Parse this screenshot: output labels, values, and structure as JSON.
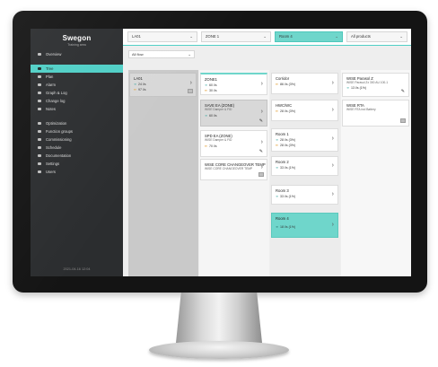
{
  "app": {
    "logo": "Swegon",
    "logo_sub": "Training area"
  },
  "sidebar": {
    "items": [
      {
        "label": "Overview",
        "icon": "dashboard-icon"
      },
      {
        "label": "Tree",
        "icon": "tree-icon",
        "active": true
      },
      {
        "label": "Plan",
        "icon": "map-pin-icon"
      },
      {
        "label": "Alarm",
        "icon": "bell-icon"
      },
      {
        "label": "Graph & Log",
        "icon": "graph-icon"
      },
      {
        "label": "Change log",
        "icon": "clipboard-icon"
      },
      {
        "label": "Notes",
        "icon": "note-icon"
      },
      {
        "label": "Optimization",
        "icon": "optimization-icon"
      },
      {
        "label": "Function groups",
        "icon": "puzzle-icon"
      },
      {
        "label": "Commissioning",
        "icon": "grid-icon"
      },
      {
        "label": "Schedule",
        "icon": "calendar-icon"
      },
      {
        "label": "Documentation",
        "icon": "document-icon"
      },
      {
        "label": "Settings",
        "icon": "gear-icon"
      },
      {
        "label": "Users",
        "icon": "users-icon"
      }
    ],
    "footer": "2021-04-16 12:04"
  },
  "topbar": {
    "dropdowns": [
      {
        "value": "LA01"
      },
      {
        "value": "ZONE 1"
      },
      {
        "value": "Room 4",
        "selected": true
      },
      {
        "value": "All products"
      }
    ]
  },
  "filter": {
    "value": "All flow"
  },
  "cards": {
    "la01": {
      "title": "LA01",
      "row1": "24 l/s",
      "row2": "97 l/s"
    },
    "zone1": {
      "title": "ZONE1",
      "row1": "60 l/s",
      "row2": "30 l/s"
    },
    "sav": {
      "title": "SAVE EA (ZONE)",
      "sub": "WISE Damper & FID",
      "row1": "60 l/s"
    },
    "spd": {
      "title": "SPD EA (ZONE)",
      "sub": "WISE Damper & FID",
      "row1": "70 l/s"
    },
    "wise_core": {
      "title": "WISE CORE CHANGEOVER TEMP",
      "sub": "WISE CORE CHANGEOVER TEMP"
    },
    "corridor": {
      "title": "Corridor",
      "row1": "86 l/s (3%)"
    },
    "hwc": {
      "title": "HWC/WC",
      "row1": "28 l/s (3%)"
    },
    "room1": {
      "title": "Room 1",
      "row1": "28 l/s (3%)",
      "row2": "28 l/s (3%)"
    },
    "room2": {
      "title": "Room 2",
      "row1": "33 l/s (1%)"
    },
    "room3": {
      "title": "Room 3",
      "row1": "33 l/s (1%)"
    },
    "room4": {
      "title": "Room 4",
      "row1": "18 l/s (1%)"
    },
    "wise_p": {
      "title": "WISE Parasol Z",
      "sub": "WISE Parasol Zx 300 AU 100-1",
      "row1": "13 l/s (1%)"
    },
    "wise_rta": {
      "title": "WISE RTA",
      "sub": "WISE RTA incl Battery"
    }
  }
}
